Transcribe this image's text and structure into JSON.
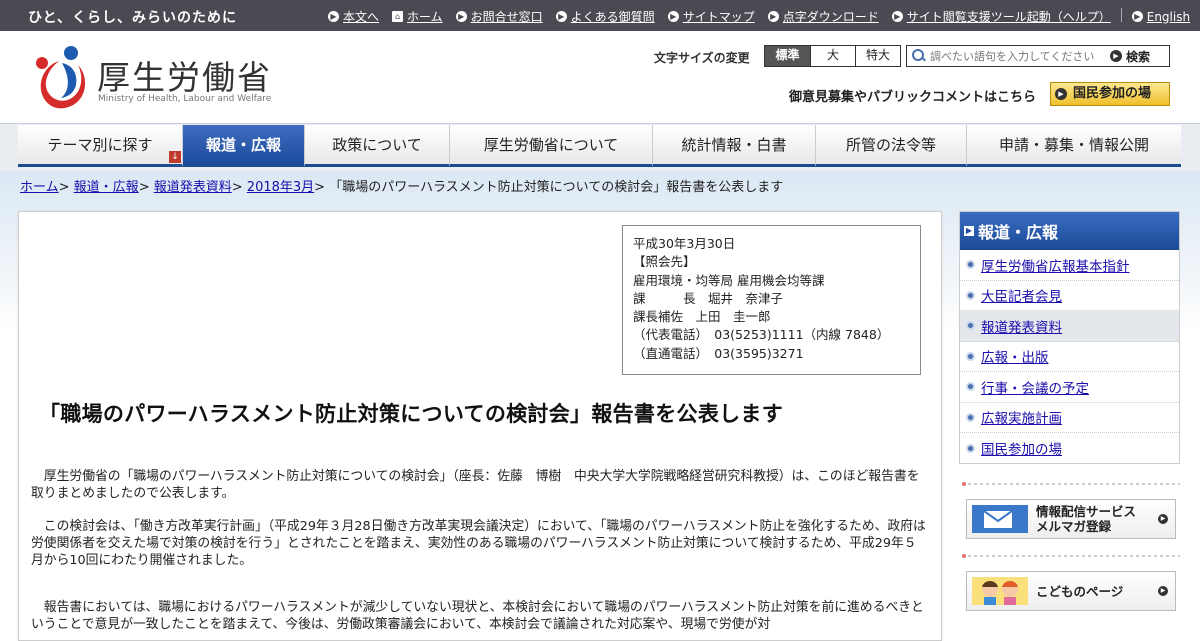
{
  "topbar": {
    "tagline": "ひと、くらし、みらいのために",
    "links": [
      "本文へ",
      "ホーム",
      "お問合せ窓口",
      "よくある御質問",
      "サイトマップ",
      "点字ダウンロード",
      "サイト閲覧支援ツール起動（ヘルプ）",
      "English"
    ]
  },
  "header": {
    "ministry_name": "厚生労働省",
    "ministry_en": "Ministry of Health, Labour and Welfare",
    "fontsize_label": "文字サイズの変更",
    "fontsize_options": [
      "標準",
      "大",
      "特大"
    ],
    "search_placeholder": "調べたい語句を入力してください",
    "search_button": "検索",
    "pubcomment": "御意見募集やパブリックコメントはこちら",
    "kokumin_button": "国民参加の場"
  },
  "nav": {
    "items": [
      "テーマ別に探す",
      "報道・広報",
      "政策について",
      "厚生労働省について",
      "統計情報・白書",
      "所管の法令等",
      "申請・募集・情報公開"
    ],
    "active": "報道・広報"
  },
  "breadcrumb": {
    "links": [
      "ホーム",
      "報道・広報",
      "報道発表資料",
      "2018年3月"
    ],
    "separator": ">",
    "current": "「職場のパワーハラスメント防止対策についての検討会」報告書を公表します"
  },
  "contact_box": "平成30年3月30日\n【照会先】\n雇用環境・均等局 雇用機会均等課\n課　　　長　堀井　奈津子\n課長補佐　上田　圭一郎\n（代表電話）　03(5253)1111（内線 7848）\n（直通電話）　03(3595)3271",
  "article": {
    "title": "「職場のパワーハラスメント防止対策についての検討会」報告書を公表します",
    "p1": "　厚生労働省の「職場のパワーハラスメント防止対策についての検討会」（座長：佐藤　博樹　中央大学大学院戦略経営研究科教授）は、このほど報告書を取りまとめましたので公表します。",
    "p2": "　この検討会は、「働き方改革実行計画」（平成29年３月28日働き方改革実現会議決定）において、「職場のパワーハラスメント防止を強化するため、政府は労使関係者を交えた場で対策の検討を行う」とされたことを踏まえ、実効性のある職場のパワーハラスメント防止対策について検討するため、平成29年５月から10回にわたり開催されました。",
    "p3": "　報告書においては、職場におけるパワーハラスメントが減少していない現状と、本検討会において職場のパワーハラスメント防止対策を前に進めるべきということで意見が一致したことを踏まえて、今後は、労働政策審議会において、本検討会で議論された対応案や、現場で労使が対"
  },
  "sidebar": {
    "heading": "報道・広報",
    "items": [
      "厚生労働省広報基本指針",
      "大臣記者会見",
      "報道発表資料",
      "広報・出版",
      "行事・会議の予定",
      "広報実施計画",
      "国民参加の場"
    ],
    "current": "報道発表資料"
  },
  "banners": {
    "mailmag": "情報配信サービス\nメルマガ登録",
    "kids": "こどものページ"
  },
  "colors": {
    "topbar": "#4a4a52",
    "nav_active": "#1c4c9c",
    "link": "#1a0dab",
    "kokumin": "#f0c02d"
  }
}
